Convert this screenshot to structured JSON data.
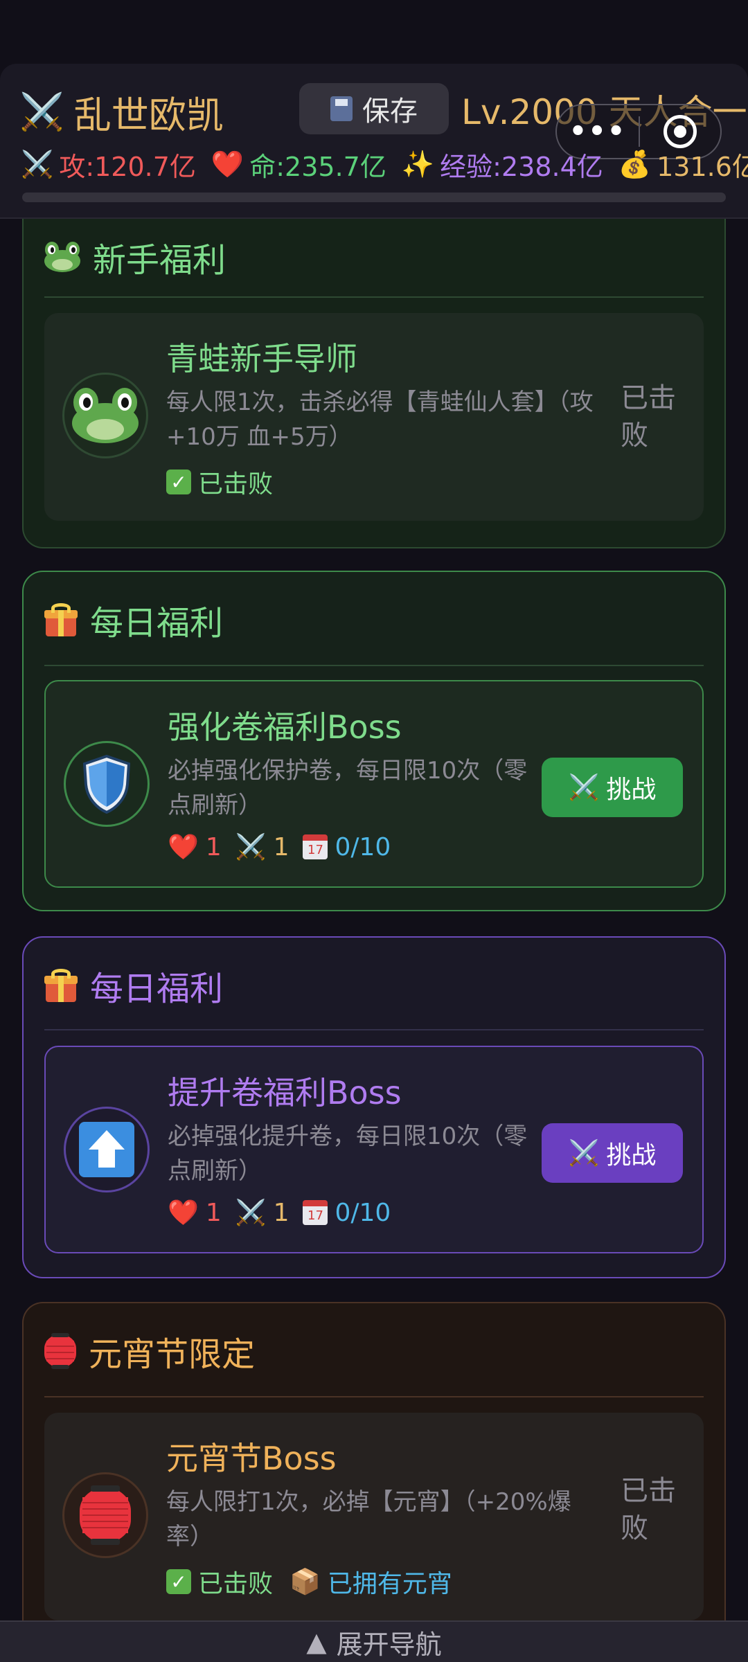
{
  "header": {
    "title": "乱世欧凯",
    "save_label": "保存",
    "level": "Lv.2000 天人合一",
    "stats": {
      "attack": "攻:120.7亿",
      "hp": "命:235.7亿",
      "exp": "经验:238.4亿",
      "gold": "131.6亿"
    },
    "progress": 0.0
  },
  "sections": {
    "newbie": {
      "title": "新手福利",
      "boss_name": "青蛙新手导师",
      "desc": "每人限1次，击杀必得【青蛙仙人套】（攻+10万 血+5万）",
      "status": "已击败",
      "side_status": "已击败"
    },
    "daily1": {
      "title": "每日福利",
      "boss_name": "强化卷福利Boss",
      "desc": "必掉强化保护卷，每日限10次（零点刷新）",
      "hp": "1",
      "atk": "1",
      "count": "0/10",
      "button": "挑战"
    },
    "daily2": {
      "title": "每日福利",
      "boss_name": "提升卷福利Boss",
      "desc": "必掉强化提升卷，每日限10次（零点刷新）",
      "hp": "1",
      "atk": "1",
      "count": "0/10",
      "button": "挑战"
    },
    "lantern": {
      "title": "元宵节限定",
      "boss_name": "元宵节Boss",
      "desc": "每人限打1次，必掉【元宵】（+20%爆率）",
      "status": "已击败",
      "owned": "已拥有元宵",
      "side_status": "已击败"
    }
  },
  "bottom_nav": {
    "arrow": "▲",
    "label": "展开导航"
  },
  "colors": {
    "bg": "#110f18",
    "gold": "#e6b96a",
    "green": "#5bd17a",
    "purple": "#b07cf0",
    "red": "#f05a5a"
  }
}
